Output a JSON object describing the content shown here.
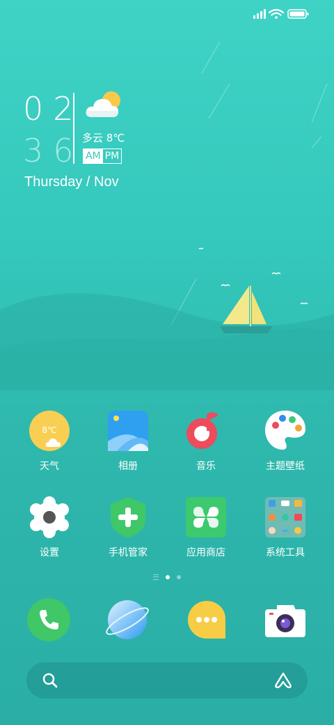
{
  "clock": {
    "hour": "02",
    "minute": "36",
    "am": "AM",
    "pm": "PM"
  },
  "weather": {
    "condition": "多云",
    "temperature": "8℃"
  },
  "date": "Thursday / Nov",
  "apps": [
    {
      "label": "天气",
      "icon_text": "8℃",
      "icon": "weather-icon"
    },
    {
      "label": "相册",
      "icon": "gallery-icon"
    },
    {
      "label": "音乐",
      "icon": "music-icon"
    },
    {
      "label": "主题壁纸",
      "icon": "palette-icon"
    },
    {
      "label": "设置",
      "icon": "settings-gear-icon"
    },
    {
      "label": "手机管家",
      "icon": "shield-plus-icon"
    },
    {
      "label": "应用商店",
      "icon": "app-store-icon"
    },
    {
      "label": "系统工具",
      "icon": "folder-icon"
    }
  ],
  "dock": [
    "phone-icon",
    "browser-icon",
    "messages-icon",
    "camera-icon"
  ],
  "pager": {
    "pages": 2,
    "current": 1
  },
  "colors": {
    "accent": "#3fd3c6",
    "sail": "#f4e98a",
    "dock_bg": "#2aaea6"
  }
}
